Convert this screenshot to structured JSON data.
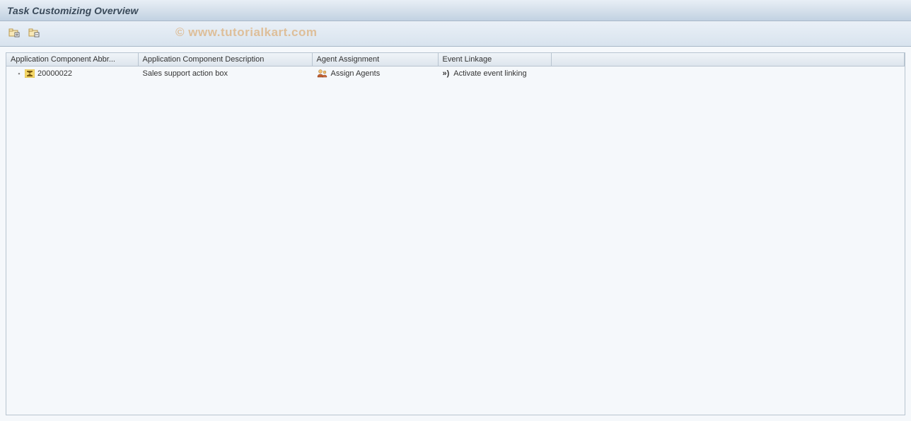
{
  "title": "Task Customizing Overview",
  "watermark": "© www.tutorialkart.com",
  "toolbar": {
    "expand_tooltip": "Expand all",
    "collapse_tooltip": "Collapse all"
  },
  "columns": {
    "abbr": "Application Component Abbr...",
    "desc": "Application Component Description",
    "agent": "Agent Assignment",
    "event": "Event Linkage"
  },
  "rows": [
    {
      "abbr": "20000022",
      "desc": "Sales support action box",
      "agent": "Assign Agents",
      "event": "Activate event linking"
    }
  ]
}
